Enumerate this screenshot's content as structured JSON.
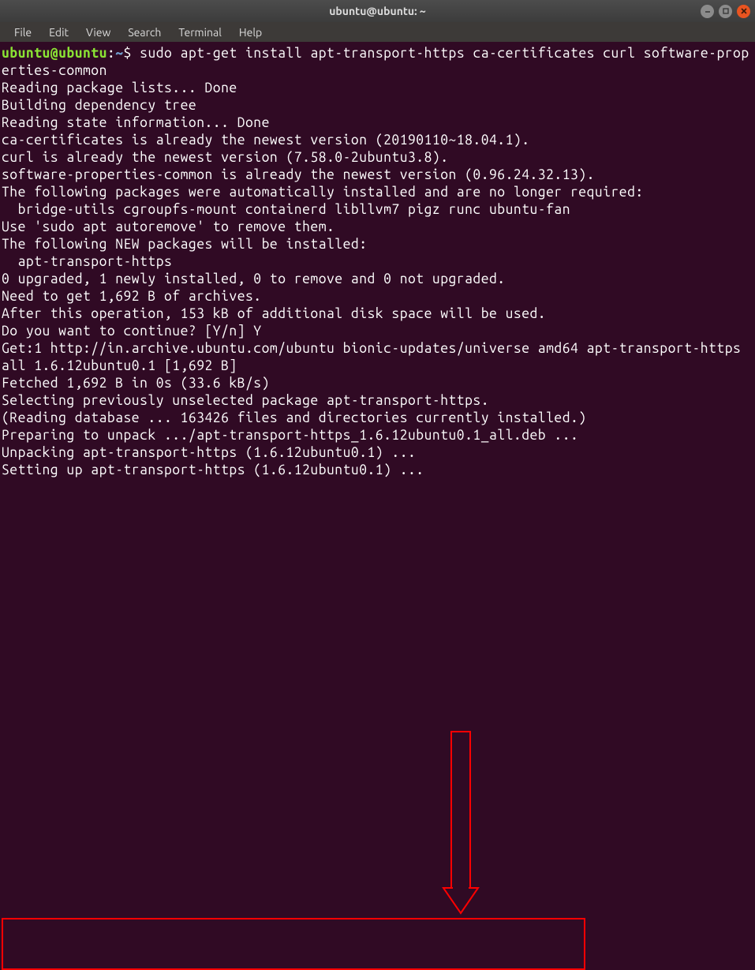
{
  "window": {
    "title": "ubuntu@ubuntu: ~"
  },
  "menu": {
    "file": "File",
    "edit": "Edit",
    "view": "View",
    "search": "Search",
    "terminal": "Terminal",
    "help": "Help"
  },
  "prompt": {
    "userhost": "ubuntu@ubuntu",
    "sep1": ":",
    "path": "~",
    "sep2": "$ "
  },
  "command": "sudo apt-get install apt-transport-https ca-certificates curl software-properties-common",
  "output": {
    "l1": "Reading package lists... Done",
    "l2": "Building dependency tree",
    "l3": "Reading state information... Done",
    "l4": "ca-certificates is already the newest version (20190110~18.04.1).",
    "l5": "curl is already the newest version (7.58.0-2ubuntu3.8).",
    "l6": "software-properties-common is already the newest version (0.96.24.32.13).",
    "l7": "The following packages were automatically installed and are no longer required:",
    "l8": "  bridge-utils cgroupfs-mount containerd libllvm7 pigz runc ubuntu-fan",
    "l9": "Use 'sudo apt autoremove' to remove them.",
    "l10": "The following NEW packages will be installed:",
    "l11": "  apt-transport-https",
    "l12": "0 upgraded, 1 newly installed, 0 to remove and 0 not upgraded.",
    "l13": "Need to get 1,692 B of archives.",
    "l14": "After this operation, 153 kB of additional disk space will be used.",
    "l15": "Do you want to continue? [Y/n] Y",
    "l16": "Get:1 http://in.archive.ubuntu.com/ubuntu bionic-updates/universe amd64 apt-transport-https all 1.6.12ubuntu0.1 [1,692 B]",
    "l17": "Fetched 1,692 B in 0s (33.6 kB/s)",
    "l18": "Selecting previously unselected package apt-transport-https.",
    "l19": "(Reading database ... 163426 files and directories currently installed.)",
    "l20": "Preparing to unpack .../apt-transport-https_1.6.12ubuntu0.1_all.deb ...",
    "l21": "Unpacking apt-transport-https (1.6.12ubuntu0.1) ...",
    "l22": "Setting up apt-transport-https (1.6.12ubuntu0.1) ..."
  },
  "annotations": {
    "arrow": "red-arrow-pointing-down",
    "highlight": "red-rectangle-highlight"
  }
}
